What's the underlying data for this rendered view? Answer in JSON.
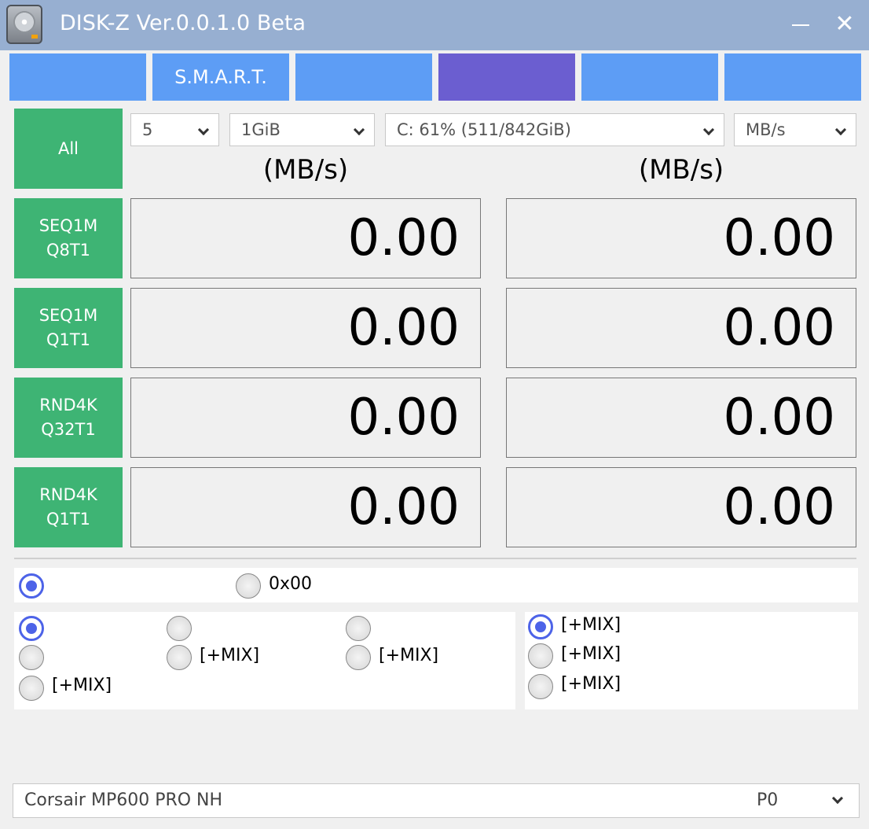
{
  "window": {
    "title": "DISK-Z Ver.0.0.1.0 Beta",
    "min_glyph": "",
    "close_glyph": "✕"
  },
  "tabs": [
    {
      "label": ""
    },
    {
      "label": "S.M.A.R.T."
    },
    {
      "label": ""
    },
    {
      "label": "",
      "active": true
    },
    {
      "label": ""
    },
    {
      "label": ""
    }
  ],
  "controls": {
    "all_button": "All",
    "count": {
      "value": "5"
    },
    "size": {
      "value": "1GiB"
    },
    "drive": {
      "value": "C: 61% (511/842GiB)"
    },
    "unit": {
      "value": "MB/s"
    }
  },
  "headers": {
    "read": "(MB/s)",
    "write": "(MB/s)"
  },
  "tests": [
    {
      "line1": "SEQ1M",
      "line2": "Q8T1",
      "read": "0.00",
      "write": "0.00"
    },
    {
      "line1": "SEQ1M",
      "line2": "Q1T1",
      "read": "0.00",
      "write": "0.00"
    },
    {
      "line1": "RND4K",
      "line2": "Q32T1",
      "read": "0.00",
      "write": "0.00"
    },
    {
      "line1": "RND4K",
      "line2": "Q1T1",
      "read": "0.00",
      "write": "0.00"
    }
  ],
  "data_fill": {
    "options": [
      {
        "label": "",
        "selected": true
      },
      {
        "label": "0x00",
        "selected": false
      }
    ]
  },
  "profile": {
    "options": [
      {
        "label": "",
        "selected": true
      },
      {
        "label": "",
        "selected": false
      },
      {
        "label": "",
        "selected": false
      },
      {
        "label": "",
        "selected": false
      },
      {
        "label": "[+MIX]",
        "selected": false
      },
      {
        "label": "[+MIX]",
        "selected": false
      },
      {
        "label": "[+MIX]",
        "selected": false
      }
    ]
  },
  "mode": {
    "options": [
      {
        "label": "[+MIX]",
        "selected": true
      },
      {
        "label": "[+MIX]",
        "selected": false
      },
      {
        "label": "[+MIX]",
        "selected": false
      }
    ]
  },
  "status": {
    "drive_name": "Corsair MP600 PRO NH",
    "profile": "P0"
  },
  "colors": {
    "tab": "#5d9df5",
    "tab_active": "#6b5ed0",
    "test_button": "#3eb474",
    "radio_selected": "#4d63e8"
  }
}
